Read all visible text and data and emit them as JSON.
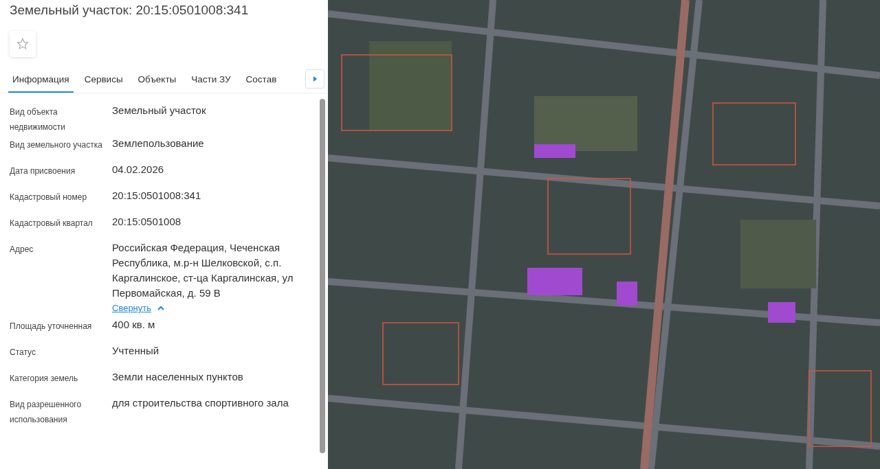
{
  "title": "Земельный участок: 20:15:0501008:341",
  "tabs": [
    {
      "label": "Информация",
      "selected": true
    },
    {
      "label": "Сервисы",
      "selected": false
    },
    {
      "label": "Объекты",
      "selected": false
    },
    {
      "label": "Части ЗУ",
      "selected": false
    },
    {
      "label": "Состав",
      "selected": false
    }
  ],
  "fields": [
    {
      "label": "Вид объекта недвижимости",
      "value": "Земельный участок"
    },
    {
      "label": "Вид земельного участка",
      "value": "Землепользование"
    },
    {
      "label": "Дата присвоения",
      "value": "04.02.2026"
    },
    {
      "label": "Кадастровый номер",
      "value": "20:15:0501008:341"
    },
    {
      "label": "Кадастровый квартал",
      "value": "20:15:0501008"
    },
    {
      "label": "Адрес",
      "value": "Российская Федерация, Чеченская Республика, м.р-н Шелковской, с.п. Каргалинское, ст-ца Каргалинская, ул Первомайская, д. 59 В",
      "link": "Свернуть",
      "expanded": true
    },
    {
      "label": "Площадь уточненная",
      "value": "400 кв. м"
    },
    {
      "label": "Статус",
      "value": "Учтенный"
    },
    {
      "label": "Категория земель",
      "value": "Земли населенных пунктов"
    },
    {
      "label": "Вид разрешенного использования",
      "value": "для строительства спортивного зала"
    }
  ]
}
